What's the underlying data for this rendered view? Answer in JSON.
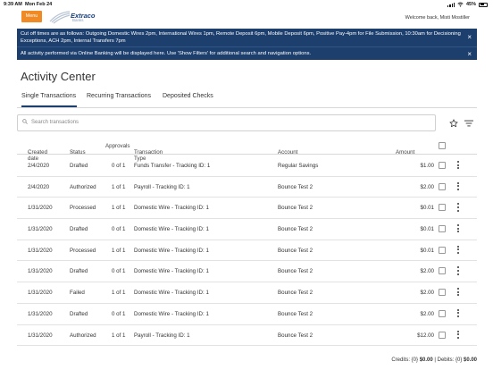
{
  "status_bar": {
    "time": "9:39 AM",
    "date": "Mon Feb 24",
    "battery": "45%"
  },
  "header": {
    "menu_label": "Menu",
    "logo_name": "Extraco",
    "logo_sub": "Banks",
    "welcome": "Welcome back, Misti Mostiller"
  },
  "banners": [
    {
      "text": "Cut off times are as follows: Outgoing Domestic Wires 2pm, International Wires 1pm, Remote Deposit 6pm, Mobile Deposit 6pm, Positive Pay-4pm for File Submission, 10:30am for Decisioning Exceptions, ACH 2pm, Internal Transfers 7pm",
      "close": "×"
    },
    {
      "text": "All activity performed via Online Banking will be displayed here. Use 'Show Filters' for additional search and navigation options.",
      "close": "×"
    }
  ],
  "page_title": "Activity Center",
  "tabs": [
    {
      "label": "Single Transactions",
      "active": true
    },
    {
      "label": "Recurring Transactions",
      "active": false
    },
    {
      "label": "Deposited Checks",
      "active": false
    }
  ],
  "search": {
    "placeholder": "Search transactions"
  },
  "table": {
    "columns": {
      "created": "Created date",
      "status": "Status",
      "approvals": "Approvals",
      "type": "Transaction Type",
      "account": "Account",
      "amount": "Amount"
    },
    "sort_caret": "⌄",
    "rows": [
      {
        "date": "2/4/2020",
        "status": "Drafted",
        "approvals": "0 of 1",
        "type": "Funds Transfer - Tracking ID: 1",
        "account": "Regular Savings",
        "amount": "$1.00"
      },
      {
        "date": "2/4/2020",
        "status": "Authorized",
        "approvals": "1 of 1",
        "type": "Payroll - Tracking ID: 1",
        "account": "Bounce Test 2",
        "amount": "$2.00"
      },
      {
        "date": "1/31/2020",
        "status": "Processed",
        "approvals": "1 of 1",
        "type": "Domestic Wire - Tracking ID: 1",
        "account": "Bounce Test 2",
        "amount": "$0.01"
      },
      {
        "date": "1/31/2020",
        "status": "Drafted",
        "approvals": "0 of 1",
        "type": "Domestic Wire - Tracking ID: 1",
        "account": "Bounce Test 2",
        "amount": "$0.01"
      },
      {
        "date": "1/31/2020",
        "status": "Processed",
        "approvals": "1 of 1",
        "type": "Domestic Wire - Tracking ID: 1",
        "account": "Bounce Test 2",
        "amount": "$0.01"
      },
      {
        "date": "1/31/2020",
        "status": "Drafted",
        "approvals": "0 of 1",
        "type": "Domestic Wire - Tracking ID: 1",
        "account": "Bounce Test 2",
        "amount": "$2.00"
      },
      {
        "date": "1/31/2020",
        "status": "Failed",
        "approvals": "1 of 1",
        "type": "Domestic Wire - Tracking ID: 1",
        "account": "Bounce Test 2",
        "amount": "$2.00"
      },
      {
        "date": "1/31/2020",
        "status": "Drafted",
        "approvals": "0 of 1",
        "type": "Domestic Wire - Tracking ID: 1",
        "account": "Bounce Test 2",
        "amount": "$2.00"
      },
      {
        "date": "1/31/2020",
        "status": "Authorized",
        "approvals": "1 of 1",
        "type": "Payroll - Tracking ID: 1",
        "account": "Bounce Test 2",
        "amount": "$12.00"
      }
    ]
  },
  "totals": {
    "credits_label": "Credits: {0}",
    "credits_value": "$0.00",
    "separator": " | ",
    "debits_label": "Debits: {0}",
    "debits_value": "$0.00"
  },
  "colors": {
    "brand_navy": "#1d3f6e",
    "menu_orange": "#f08a24"
  }
}
